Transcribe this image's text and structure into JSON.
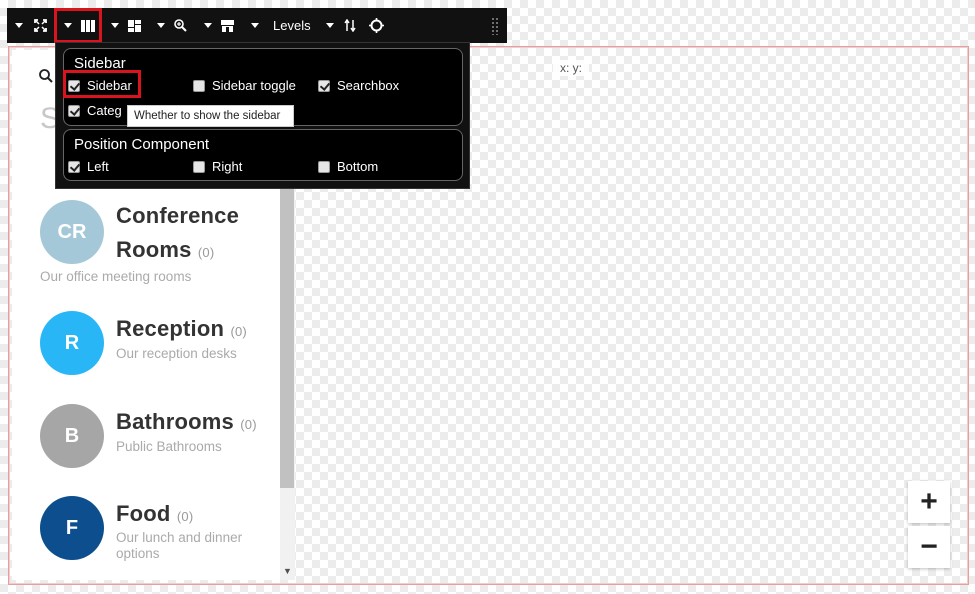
{
  "map": {
    "coords": "x: y:"
  },
  "toolbar": {
    "levels_label": "Levels",
    "icons": [
      "fullscreen-icon",
      "columns-icon",
      "layout-icon",
      "zoom-icon",
      "building-icon",
      "swap-icon",
      "crosshair-icon"
    ]
  },
  "dropdown": {
    "sidebar_section": {
      "title": "Sidebar",
      "options": [
        {
          "label": "Sidebar",
          "checked": true
        },
        {
          "label": "Sidebar toggle",
          "checked": false
        },
        {
          "label": "Searchbox",
          "checked": true
        },
        {
          "label": "Categ",
          "checked": true
        }
      ]
    },
    "position_section": {
      "title": "Position Component",
      "options": [
        {
          "label": "Left",
          "checked": true
        },
        {
          "label": "Right",
          "checked": false
        },
        {
          "label": "Bottom",
          "checked": false
        }
      ]
    },
    "tooltip": "Whether to show the sidebar"
  },
  "sidebar": {
    "search_placeholder": "S",
    "categories": [
      {
        "initials": "CR",
        "title_line1": "Conference",
        "title_line2": "Rooms",
        "count": "(0)",
        "description": "Our office meeting rooms",
        "color": "#a5c8d8"
      },
      {
        "initials": "R",
        "title_line1": "Reception",
        "count": "(0)",
        "description": "Our reception desks",
        "color": "#29b6f6"
      },
      {
        "initials": "B",
        "title_line1": "Bathrooms",
        "count": "(0)",
        "description": "Public Bathrooms",
        "color": "#a6a6a6"
      },
      {
        "initials": "F",
        "title_line1": "Food",
        "count": "(0)",
        "description_line1": "Our lunch and dinner",
        "description_line2": "options",
        "color": "#0d4e8f"
      }
    ]
  },
  "zoom": {
    "in": "+",
    "out": "−"
  }
}
